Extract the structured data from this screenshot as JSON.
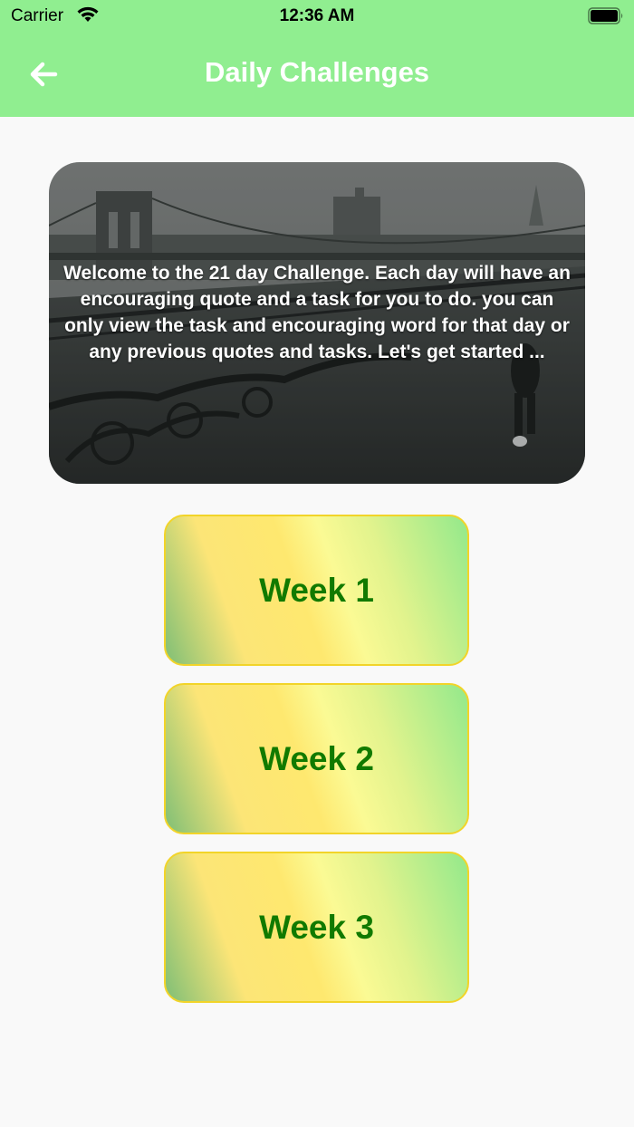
{
  "status_bar": {
    "carrier": "Carrier",
    "time": "12:36 AM"
  },
  "header": {
    "title": "Daily Challenges",
    "back_icon": "arrow-left-icon"
  },
  "banner": {
    "text": "Welcome to the 21 day Challenge. Each day will have an encouraging quote and a task for you to do. you can only view the task and encouraging word for that day or any previous quotes and tasks. Let's get started ..."
  },
  "weeks": [
    {
      "label": "Week 1"
    },
    {
      "label": "Week 2"
    },
    {
      "label": "Week 3"
    }
  ],
  "colors": {
    "header_bg": "#90ee90",
    "week_text": "#117a00",
    "card_border": "#f2d429",
    "page_bg": "#f9f9f9"
  }
}
